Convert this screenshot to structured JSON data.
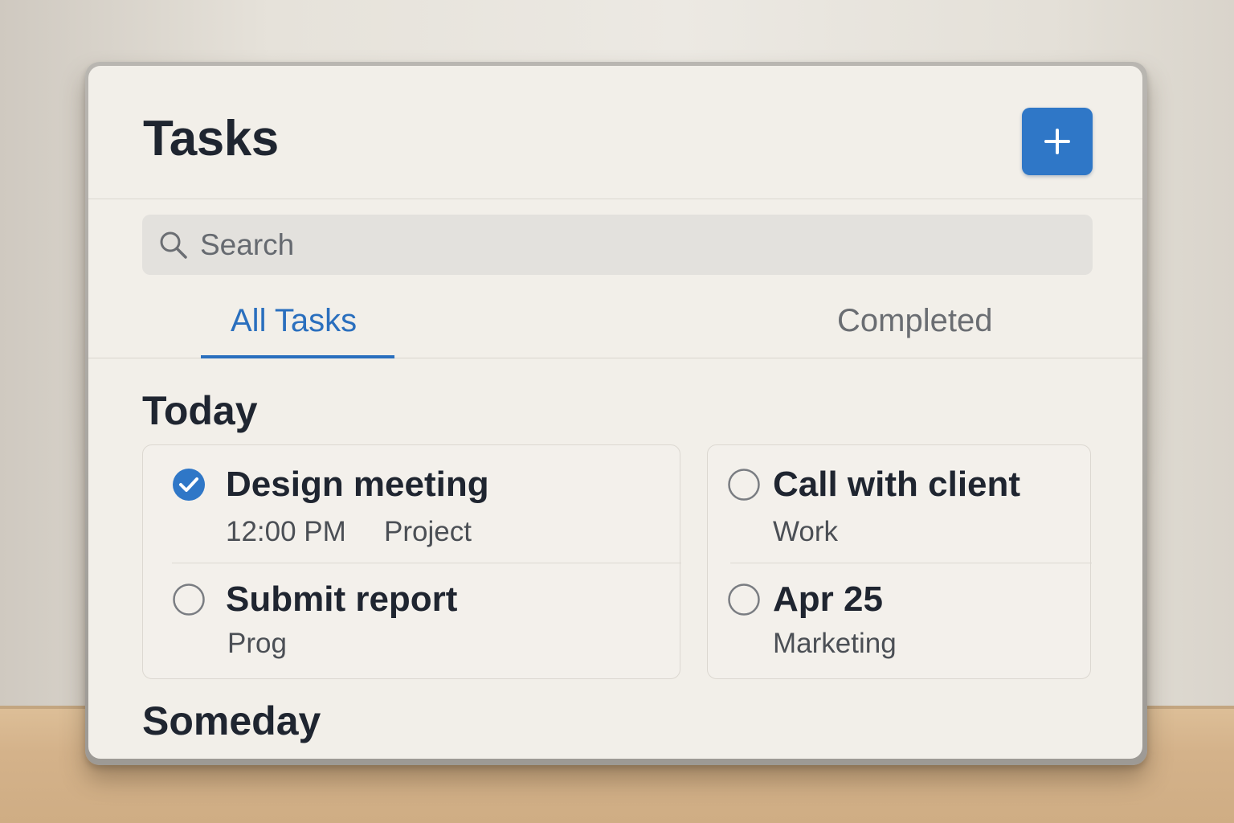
{
  "app": {
    "title": "Tasks",
    "add_button_label": "+"
  },
  "search": {
    "placeholder": "Search",
    "value": ""
  },
  "tabs": [
    {
      "label": "All Tasks",
      "active": true
    },
    {
      "label": "Completed",
      "active": false
    }
  ],
  "sections": {
    "today": {
      "title": "Today",
      "tasks": [
        {
          "name": "Design meeting",
          "time": "12:00 PM",
          "tag": "Project",
          "completed": true
        },
        {
          "name": "Submit report",
          "tag": "Prog",
          "completed": false
        },
        {
          "name": "Call with client",
          "tag": "Work",
          "completed": false
        },
        {
          "name": "Apr 25",
          "tag": "Marketing",
          "completed": false
        }
      ]
    },
    "someday": {
      "title": "Someday"
    }
  },
  "colors": {
    "accent": "#2f77c7",
    "tab_active": "#2a6fbe",
    "text_primary": "#1f2530",
    "background": "#f2efe9"
  },
  "icons": {
    "add": "plus-icon",
    "search": "search-icon",
    "checked": "check-circle-icon",
    "unchecked": "empty-circle-icon"
  }
}
